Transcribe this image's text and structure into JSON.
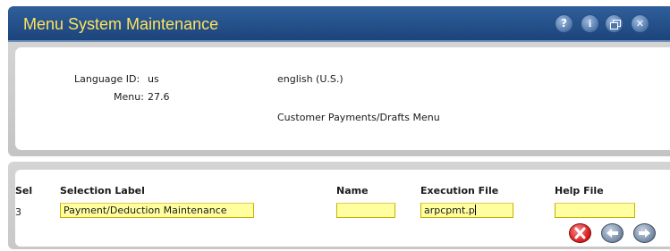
{
  "window": {
    "title": "Menu System Maintenance",
    "buttons": {
      "help_icon": "?",
      "info_icon": "i",
      "restore_icon": "restore-icon",
      "close_icon": "✕"
    },
    "colors": {
      "title_bar": "#1c447c",
      "title_text": "#ffe35c",
      "field_fill": "#ffffa0"
    }
  },
  "header": {
    "language_id_label": "Language ID:",
    "language_id_value": "us",
    "language_name": "english (U.S.)",
    "menu_label": "Menu:",
    "menu_value": "27.6",
    "menu_description": "Customer Payments/Drafts Menu"
  },
  "detail": {
    "columns": {
      "sel": "Sel",
      "selection_label": "Selection Label",
      "name": "Name",
      "execution_file": "Execution File",
      "help_file": "Help File"
    },
    "row": {
      "sel": "3",
      "selection_label": "Payment/Deduction Maintenance",
      "name": "",
      "execution_file": "arpcpmt.p",
      "help_file": ""
    }
  },
  "actions": {
    "cancel_icon": "cancel-icon",
    "back_icon": "back-arrow-icon",
    "forward_icon": "forward-arrow-icon"
  }
}
